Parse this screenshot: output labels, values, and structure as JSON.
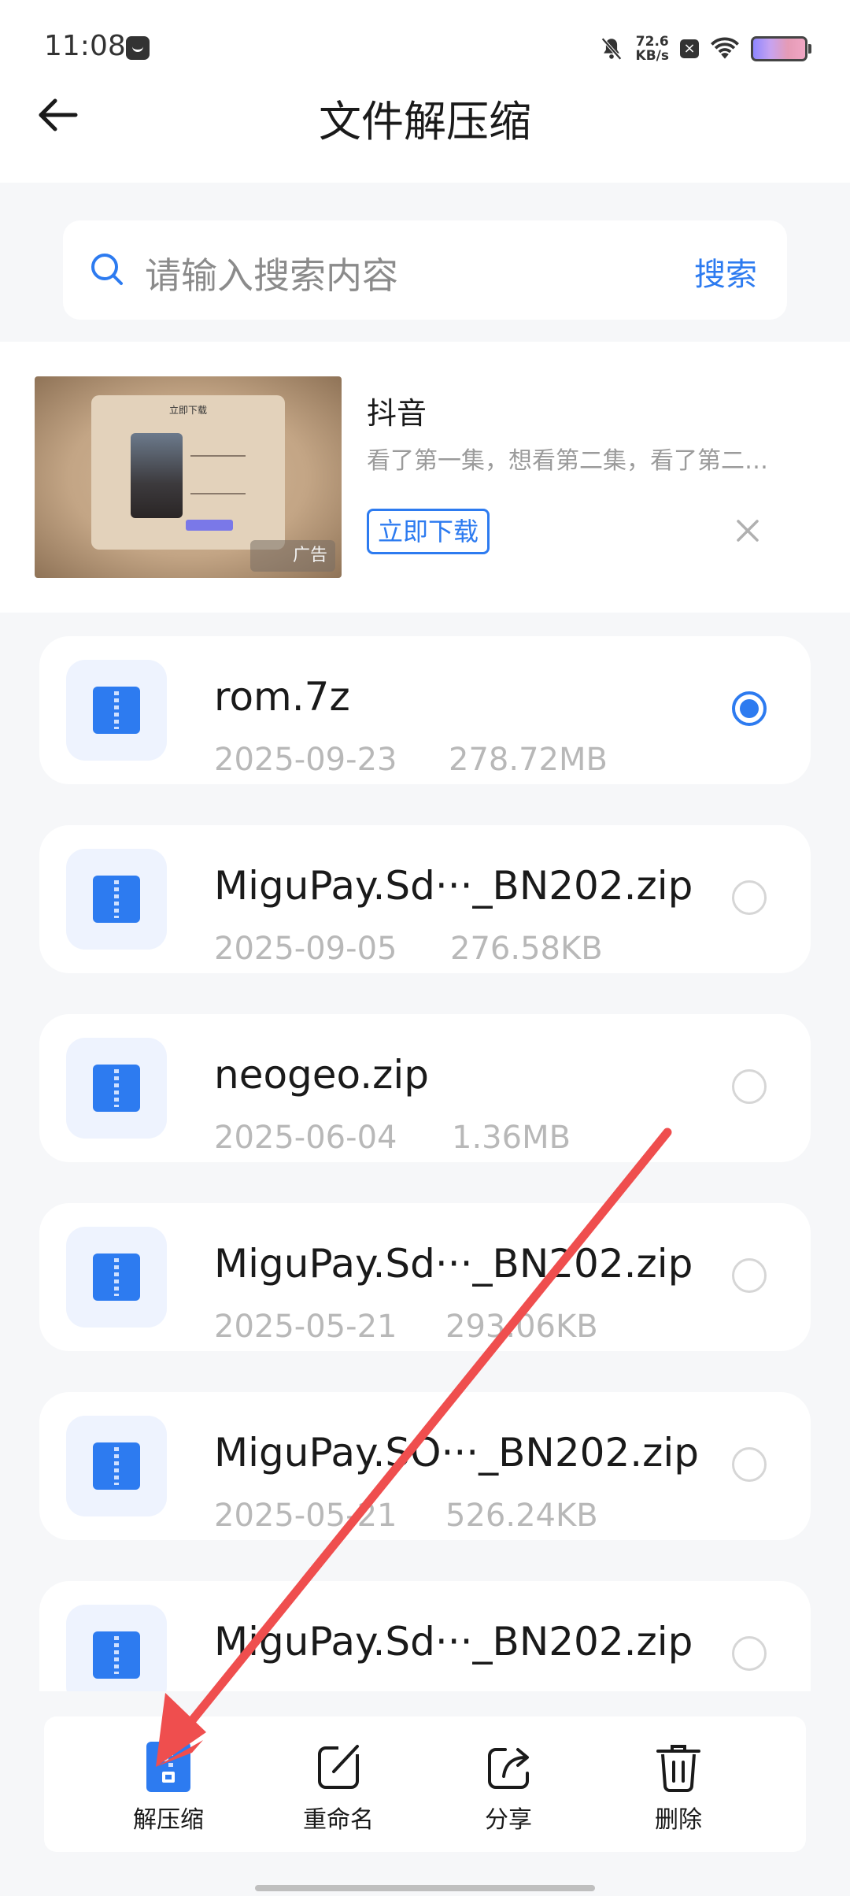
{
  "status_bar": {
    "time": "11:08",
    "net_speed_value": "72.6",
    "net_speed_unit": "KB/s"
  },
  "header": {
    "title": "文件解压缩"
  },
  "search": {
    "placeholder": "请输入搜索内容",
    "button": "搜索"
  },
  "ad": {
    "app_name": "抖音",
    "description": "看了第一集，想看第二集，看了第二…",
    "cta": "立即下载",
    "image_tag": "广告",
    "image_title": "立即下载"
  },
  "files": [
    {
      "name": "rom.7z",
      "date": "2025-09-23",
      "size": "278.72MB",
      "selected": true
    },
    {
      "name": "MiguPay.Sd···_BN202.zip",
      "date": "2025-09-05",
      "size": "276.58KB",
      "selected": false
    },
    {
      "name": "neogeo.zip",
      "date": "2025-06-04",
      "size": "1.36MB",
      "selected": false
    },
    {
      "name": "MiguPay.Sd···_BN202.zip",
      "date": "2025-05-21",
      "size": "293.06KB",
      "selected": false
    },
    {
      "name": "MiguPay.SO···_BN202.zip",
      "date": "2025-05-21",
      "size": "526.24KB",
      "selected": false
    },
    {
      "name": "MiguPay.Sd···_BN202.zip",
      "date": "",
      "size": "",
      "selected": false
    }
  ],
  "toolbar": {
    "extract": "解压缩",
    "rename": "重命名",
    "share": "分享",
    "delete": "删除"
  },
  "colors": {
    "accent": "#2d7bf0",
    "annotation_arrow": "#ef4e4e"
  }
}
